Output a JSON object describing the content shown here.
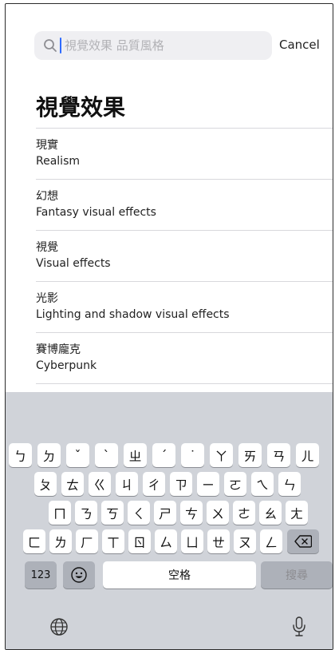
{
  "search": {
    "placeholder": "視覺效果 品質風格",
    "value": "",
    "cancel_label": "Cancel"
  },
  "title": "視覺效果",
  "items": [
    {
      "zh": "現實",
      "en": "Realism"
    },
    {
      "zh": "幻想",
      "en": "Fantasy visual effects"
    },
    {
      "zh": "視覺",
      "en": "Visual effects"
    },
    {
      "zh": "光影",
      "en": "Lighting and shadow visual effects"
    },
    {
      "zh": "賽博龐克",
      "en": "Cyberpunk"
    }
  ],
  "keyboard": {
    "row1": [
      "ㄅ",
      "ㄉ",
      "ˇ",
      "ˋ",
      "ㄓ",
      "ˊ",
      "˙",
      "ㄚ",
      "ㄞ",
      "ㄢ",
      "ㄦ"
    ],
    "row2": [
      "ㄆ",
      "ㄊ",
      "ㄍ",
      "ㄐ",
      "ㄔ",
      "ㄗ",
      "ㄧ",
      "ㄛ",
      "ㄟ",
      "ㄣ"
    ],
    "row3": [
      "ㄇ",
      "ㄋ",
      "ㄎ",
      "ㄑ",
      "ㄕ",
      "ㄘ",
      "ㄨ",
      "ㄜ",
      "ㄠ",
      "ㄤ"
    ],
    "row4": [
      "ㄈ",
      "ㄌ",
      "ㄏ",
      "ㄒ",
      "ㄖ",
      "ㄙ",
      "ㄩ",
      "ㄝ",
      "ㄡ",
      "ㄥ"
    ],
    "numbers_label": "123",
    "space_label": "空格",
    "search_label": "搜尋",
    "emoji_icon": "emoji-icon",
    "backspace_icon": "backspace-icon",
    "globe_icon": "globe-icon",
    "mic_icon": "microphone-icon"
  }
}
